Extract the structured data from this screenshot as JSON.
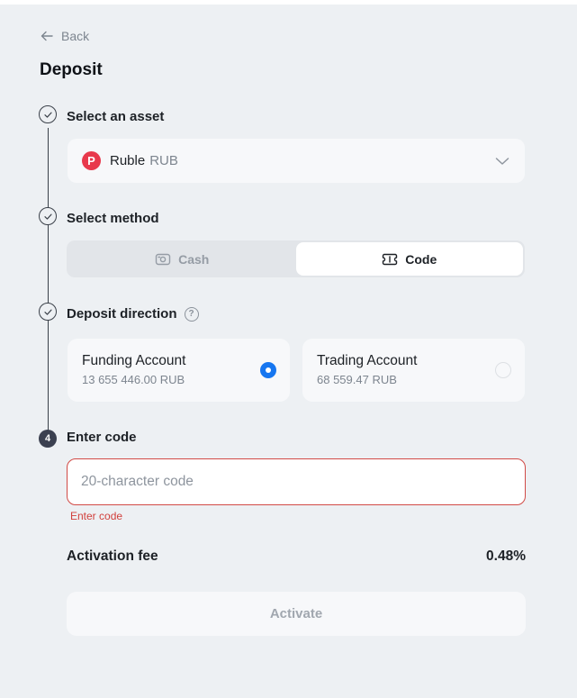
{
  "nav": {
    "back_label": "Back"
  },
  "page": {
    "title": "Deposit"
  },
  "steps": {
    "asset": {
      "label": "Select an asset"
    },
    "method": {
      "label": "Select method"
    },
    "direction": {
      "label": "Deposit direction"
    },
    "code": {
      "number": "4",
      "label": "Enter code"
    }
  },
  "asset_select": {
    "coin_symbol": "P",
    "name": "Ruble",
    "code": "RUB",
    "coin_color": "#e8394c"
  },
  "methods": [
    {
      "label": "Cash",
      "icon": "cash-icon",
      "selected": false
    },
    {
      "label": "Code",
      "icon": "code-voucher-icon",
      "selected": true
    }
  ],
  "accounts": [
    {
      "name": "Funding Account",
      "balance": "13 655 446.00 RUB",
      "selected": true
    },
    {
      "name": "Trading Account",
      "balance": "68 559.47 RUB",
      "selected": false
    }
  ],
  "code_input": {
    "value": "",
    "placeholder": "20-character code",
    "error": "Enter code"
  },
  "fee": {
    "label": "Activation fee",
    "value": "0.48%"
  },
  "actions": {
    "activate_label": "Activate"
  },
  "colors": {
    "accent": "#1676f0",
    "error": "#d1403c",
    "background": "#edf0f3"
  }
}
